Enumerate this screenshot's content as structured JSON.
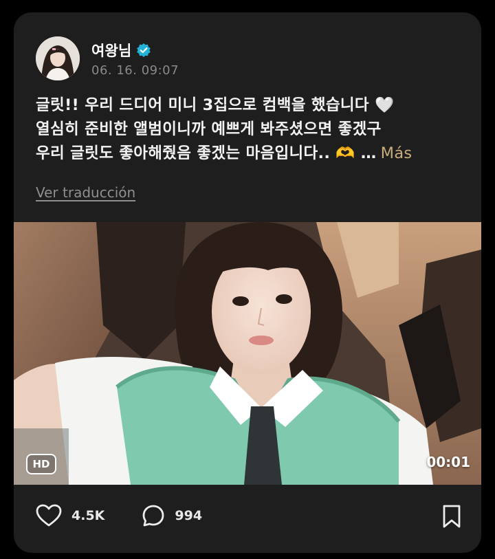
{
  "post": {
    "username": "여왕님",
    "timestamp": "06. 16. 09:07",
    "caption_lines": [
      "글릿!! 우리 드디어 미니 3집으로 컴백을 했습니다 🤍",
      "열심히 준비한 앨범이니까 예쁘게 봐주셨으면 좋겠구",
      "우리 글릿도 좋아해줬음 좋겠는 마음입니다.. 🫶 …"
    ],
    "more_label": "Más",
    "translate_label": "Ver traducción",
    "media": {
      "hd_label": "HD",
      "duration": "00:01"
    },
    "stats": {
      "likes": "4.5K",
      "comments": "994"
    }
  },
  "icons": {
    "verified": "verified-badge-icon",
    "like": "heart-icon",
    "comment": "comment-bubble-icon",
    "bookmark": "bookmark-icon"
  },
  "colors": {
    "background": "#000000",
    "card": "#1e1e1e",
    "more_link": "#c9ad7c",
    "verified": "#23b3d6",
    "sweater": "#7fcaae"
  }
}
